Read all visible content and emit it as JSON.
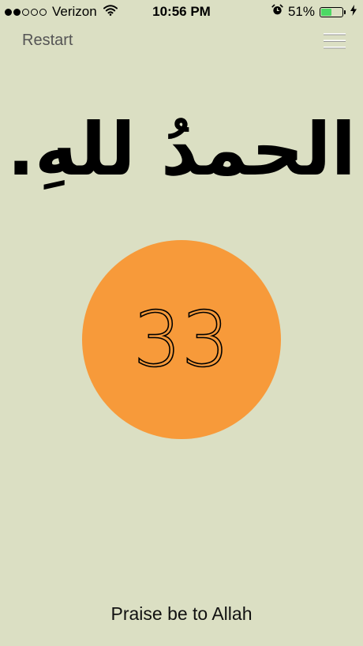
{
  "status_bar": {
    "carrier": "Verizon",
    "time": "10:56 PM",
    "battery_percent": "51%",
    "battery_level": 0.51,
    "signal_bars_filled": 2,
    "signal_bars_total": 5
  },
  "nav": {
    "restart_label": "Restart"
  },
  "dhikr": {
    "arabic": "الحمدُ للهِ.",
    "count": "33",
    "translation": "Praise be to Allah"
  },
  "colors": {
    "background": "#dbdfc3",
    "counter": "#f79a3a",
    "battery": "#4cd964"
  },
  "icons": {
    "wifi": "wifi-icon",
    "alarm": "alarm-clock-icon",
    "battery": "battery-icon",
    "charging": "lightning-bolt-icon",
    "menu": "hamburger-menu-icon"
  }
}
